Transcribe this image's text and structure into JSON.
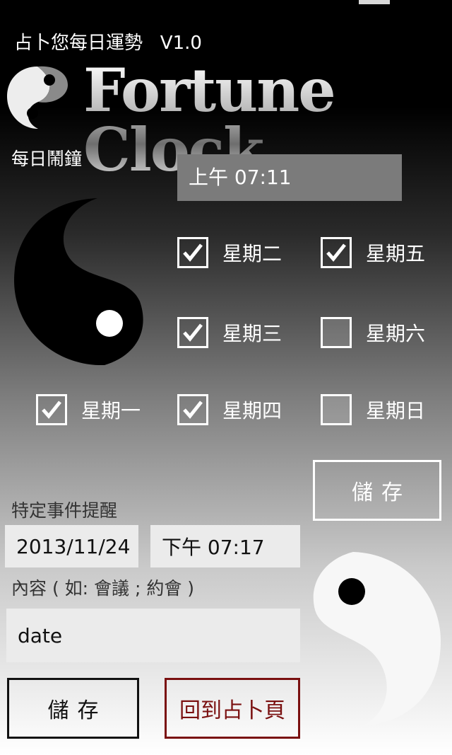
{
  "app": {
    "title": "占卜您每日運勢   V1.0",
    "logo_text": "Fortune Clock"
  },
  "alarm": {
    "label": "每日鬧鐘",
    "time": "上午 07:11",
    "days": [
      {
        "label": "星期一",
        "checked": true
      },
      {
        "label": "星期二",
        "checked": true
      },
      {
        "label": "星期三",
        "checked": true
      },
      {
        "label": "星期四",
        "checked": true
      },
      {
        "label": "星期五",
        "checked": true
      },
      {
        "label": "星期六",
        "checked": false
      },
      {
        "label": "星期日",
        "checked": false
      }
    ],
    "save_label": "儲存"
  },
  "event": {
    "label": "特定事件提醒",
    "date": "2013/11/24",
    "time": "下午 07:17",
    "content_label": "內容 ( 如: 會議 ; 約會 )",
    "content_value": "date",
    "save_label": "儲存",
    "back_label": "回到占卜頁"
  },
  "colors": {
    "back_button": "#7a1010",
    "time_box": "#7b7b7b"
  }
}
